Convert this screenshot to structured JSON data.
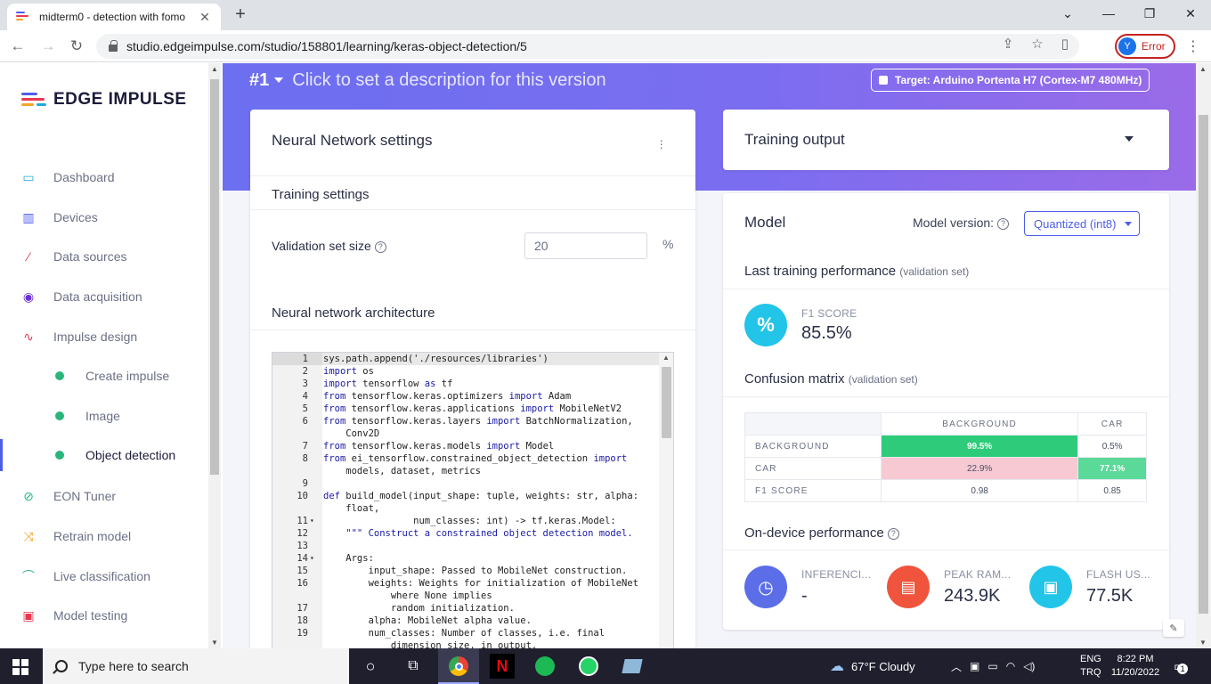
{
  "browser": {
    "tab_title": "midterm0 - detection with fomo",
    "url": "studio.edgeimpulse.com/studio/158801/learning/keras-object-detection/5",
    "profile_initial": "Y",
    "profile_status": "Error"
  },
  "sidebar": {
    "logo_text": "EDGE IMPULSE",
    "items": [
      {
        "label": "Dashboard",
        "icon": "monitor-icon",
        "color": "#22a8d8"
      },
      {
        "label": "Devices",
        "icon": "chip-icon",
        "color": "#4e5de8"
      },
      {
        "label": "Data sources",
        "icon": "wand-icon",
        "color": "#e8384f"
      },
      {
        "label": "Data acquisition",
        "icon": "database-icon",
        "color": "#6a2fd6"
      },
      {
        "label": "Impulse design",
        "icon": "pulse-icon",
        "color": "#e8384f"
      },
      {
        "label": "Create impulse",
        "sub": true
      },
      {
        "label": "Image",
        "sub": true
      },
      {
        "label": "Object detection",
        "sub": true,
        "active": true
      },
      {
        "label": "EON Tuner",
        "icon": "compass-icon",
        "color": "#2ab57d"
      },
      {
        "label": "Retrain model",
        "icon": "shuffle-icon",
        "color": "#f2a62a"
      },
      {
        "label": "Live classification",
        "icon": "broadcast-icon",
        "color": "#2ab57d"
      },
      {
        "label": "Model testing",
        "icon": "clipboard-icon",
        "color": "#e8384f"
      }
    ]
  },
  "header": {
    "version": "#1",
    "description": "Click to set a description for this version",
    "target": "Target: Arduino Portenta H7 (Cortex-M7 480MHz)"
  },
  "nn_settings": {
    "title": "Neural Network settings",
    "training_settings": "Training settings",
    "validation_label": "Validation set size",
    "validation_value": "20",
    "validation_unit": "%",
    "architecture": "Neural network architecture",
    "code": [
      {
        "n": "1",
        "t": "sys.path.append('./resources/libraries')"
      },
      {
        "n": "2",
        "t": "import os"
      },
      {
        "n": "3",
        "t": "import tensorflow as tf"
      },
      {
        "n": "4",
        "t": "from tensorflow.keras.optimizers import Adam"
      },
      {
        "n": "5",
        "t": "from tensorflow.keras.applications import MobileNetV2"
      },
      {
        "n": "6",
        "t": "from tensorflow.keras.layers import BatchNormalization,"
      },
      {
        "n": "",
        "t": "    Conv2D"
      },
      {
        "n": "7",
        "t": "from tensorflow.keras.models import Model"
      },
      {
        "n": "8",
        "t": "from ei_tensorflow.constrained_object_detection import"
      },
      {
        "n": "",
        "t": "    models, dataset, metrics"
      },
      {
        "n": "9",
        "t": ""
      },
      {
        "n": "10",
        "t": "def build_model(input_shape: tuple, weights: str, alpha:"
      },
      {
        "n": "",
        "t": "    float,"
      },
      {
        "n": "11",
        "t": "                num_classes: int) -> tf.keras.Model:",
        "fold": true
      },
      {
        "n": "12",
        "t": "    \"\"\" Construct a constrained object detection model."
      },
      {
        "n": "13",
        "t": ""
      },
      {
        "n": "14",
        "t": "    Args:",
        "fold": true
      },
      {
        "n": "15",
        "t": "        input_shape: Passed to MobileNet construction."
      },
      {
        "n": "16",
        "t": "        weights: Weights for initialization of MobileNet"
      },
      {
        "n": "",
        "t": "            where None implies"
      },
      {
        "n": "17",
        "t": "            random initialization."
      },
      {
        "n": "18",
        "t": "        alpha: MobileNet alpha value."
      },
      {
        "n": "19",
        "t": "        num_classes: Number of classes, i.e. final"
      },
      {
        "n": "",
        "t": "            dimension size, in output."
      }
    ]
  },
  "training_output": {
    "title": "Training output"
  },
  "model": {
    "title": "Model",
    "version_label": "Model version:",
    "version_value": "Quantized (int8)",
    "last_perf": "Last training performance",
    "validation_note": "(validation set)",
    "f1_label": "F1 SCORE",
    "f1_value": "85.5%",
    "confusion_title": "Confusion matrix",
    "confusion": {
      "columns": [
        "BACKGROUND",
        "CAR"
      ],
      "rows": [
        {
          "label": "BACKGROUND",
          "cells": [
            "99.5%",
            "0.5%"
          ]
        },
        {
          "label": "CAR",
          "cells": [
            "22.9%",
            "77.1%"
          ]
        },
        {
          "label": "F1 SCORE",
          "cells": [
            "0.98",
            "0.85"
          ]
        }
      ]
    },
    "ondevice_title": "On-device performance",
    "metrics": [
      {
        "label": "INFERENCI...",
        "value": "-",
        "color": "#5b6ee8"
      },
      {
        "label": "PEAK RAM...",
        "value": "243.9K",
        "color": "#f0543c"
      },
      {
        "label": "FLASH US...",
        "value": "77.5K",
        "color": "#22c5e8"
      }
    ]
  },
  "taskbar": {
    "search_placeholder": "Type here to search",
    "weather": "67°F  Cloudy",
    "lang1": "ENG",
    "lang2": "TRQ",
    "time": "8:22 PM",
    "date": "11/20/2022",
    "notif_count": "1"
  }
}
